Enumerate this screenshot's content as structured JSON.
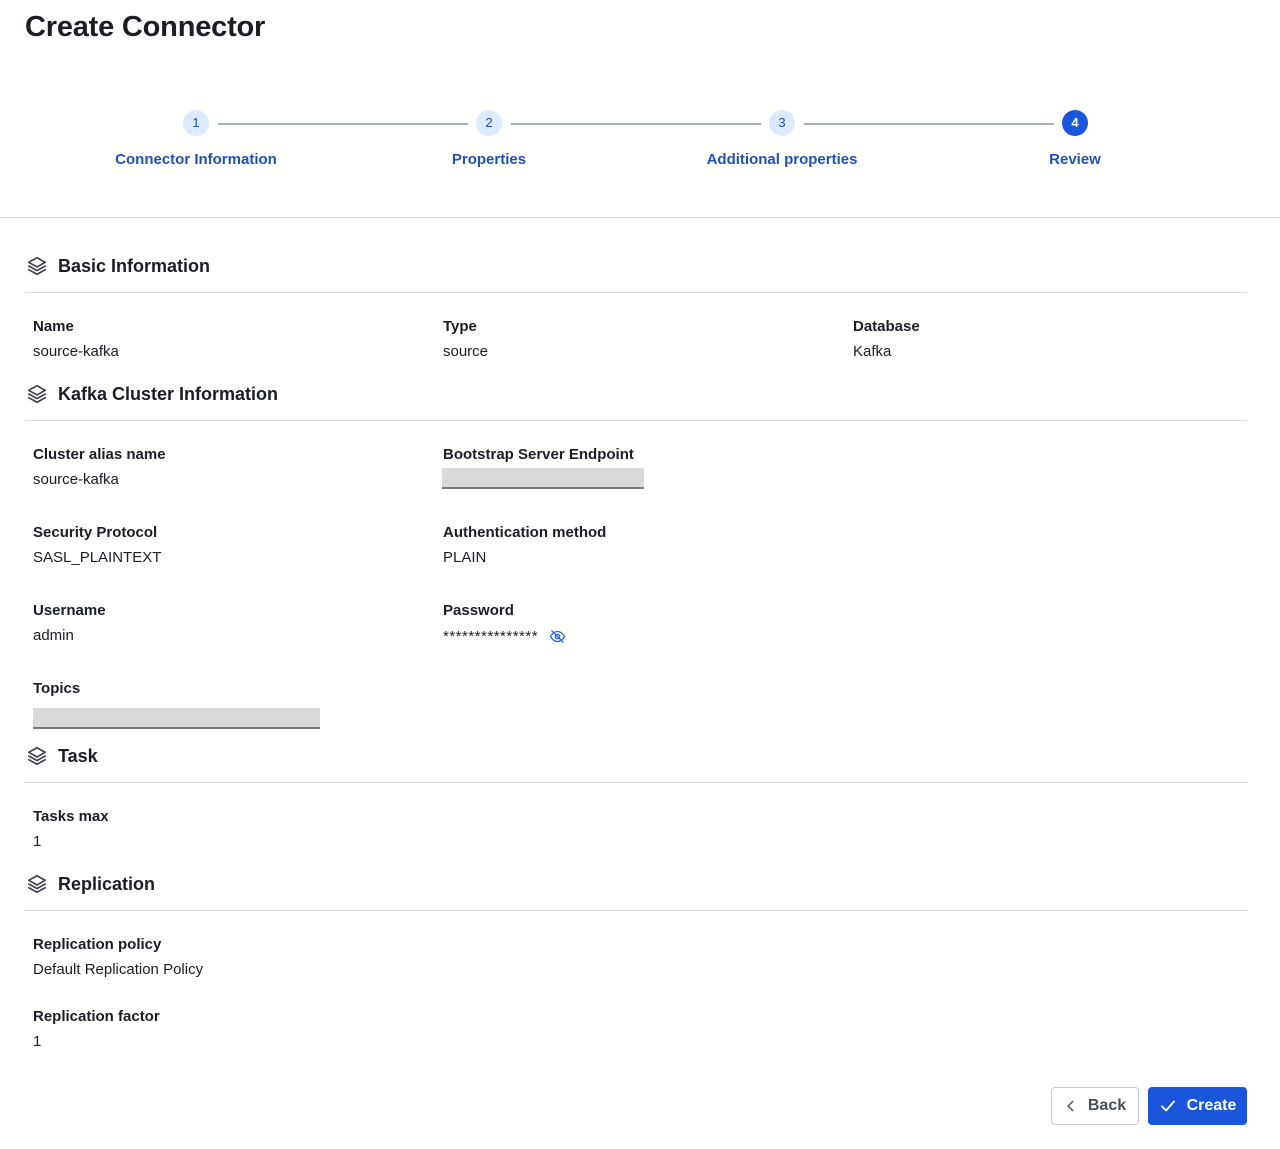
{
  "page": {
    "title": "Create Connector"
  },
  "stepper": {
    "steps": [
      {
        "number": "1",
        "label": "Connector Information",
        "active": false
      },
      {
        "number": "2",
        "label": "Properties",
        "active": false
      },
      {
        "number": "3",
        "label": "Additional properties",
        "active": false
      },
      {
        "number": "4",
        "label": "Review",
        "active": true
      }
    ]
  },
  "sections": {
    "basic": {
      "title": "Basic Information",
      "icon": "layers-icon",
      "fields": {
        "name": {
          "label": "Name",
          "value": "source-kafka"
        },
        "type": {
          "label": "Type",
          "value": "source"
        },
        "database": {
          "label": "Database",
          "value": "Kafka"
        }
      }
    },
    "kafka": {
      "title": "Kafka Cluster Information",
      "icon": "layers-icon",
      "fields": {
        "cluster_alias": {
          "label": "Cluster alias name",
          "value": "source-kafka"
        },
        "bootstrap": {
          "label": "Bootstrap Server Endpoint",
          "redacted": true
        },
        "security_protocol": {
          "label": "Security Protocol",
          "value": "SASL_PLAINTEXT"
        },
        "auth_method": {
          "label": "Authentication method",
          "value": "PLAIN"
        },
        "username": {
          "label": "Username",
          "value": "admin"
        },
        "password": {
          "label": "Password",
          "value": "***************",
          "toggle_icon": "eye-off-icon"
        },
        "topics": {
          "label": "Topics",
          "redacted": true
        }
      }
    },
    "task": {
      "title": "Task",
      "icon": "layers-icon",
      "fields": {
        "tasks_max": {
          "label": "Tasks max",
          "value": "1"
        }
      }
    },
    "replication": {
      "title": "Replication",
      "icon": "layers-icon",
      "fields": {
        "policy": {
          "label": "Replication policy",
          "value": "Default Replication Policy"
        },
        "factor": {
          "label": "Replication factor",
          "value": "1"
        }
      }
    }
  },
  "footer": {
    "back_label": "Back",
    "create_label": "Create",
    "back_icon": "chevron-left-icon",
    "create_icon": "check-icon"
  },
  "colors": {
    "primary": "#1a56db",
    "step_inactive_bg": "#dceaff",
    "step_label": "#2150b3",
    "divider": "#d5d8dd"
  }
}
